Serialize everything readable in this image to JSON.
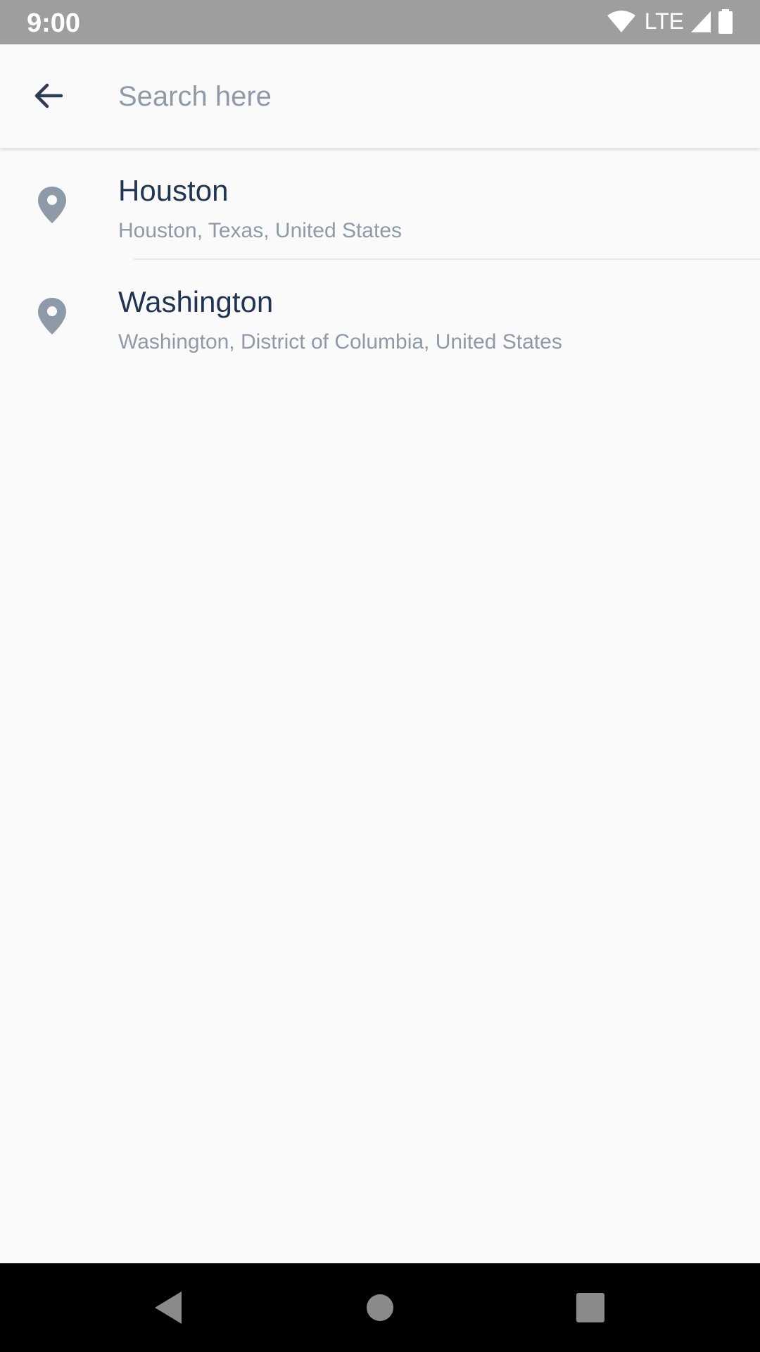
{
  "status_bar": {
    "time": "9:00",
    "network": "LTE",
    "icons": [
      "wifi-icon",
      "signal-icon",
      "battery-icon"
    ]
  },
  "search": {
    "placeholder": "Search here",
    "value": ""
  },
  "results": [
    {
      "title": "Houston",
      "subtitle": "Houston, Texas, United States",
      "icon": "location-pin-icon"
    },
    {
      "title": "Washington",
      "subtitle": "Washington, District of Columbia, United States",
      "icon": "location-pin-icon"
    }
  ],
  "nav_bar": {
    "buttons": [
      "back-icon",
      "home-icon",
      "recents-icon"
    ]
  },
  "colors": {
    "status_bar": "#9e9e9e",
    "background": "#fafafa",
    "title_text": "#1f3552",
    "subtitle_text": "#8e9aa8",
    "pin": "#8e9aa8"
  }
}
